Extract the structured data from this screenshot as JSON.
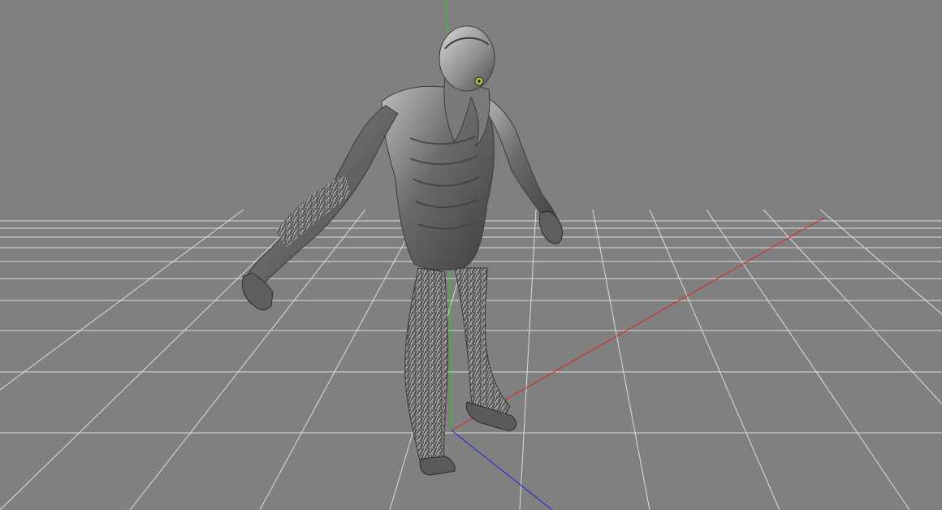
{
  "viewport": {
    "background_color": "#808080",
    "grid_color": "#e6e6e6",
    "model_base_color": "#6f6f6f",
    "model_highlight_color": "#c8c8c8",
    "model_shadow_color": "#3a3a3a",
    "eye_color": "#b7c24a"
  },
  "axes": {
    "x_axis_color": "#e02020",
    "y_axis_color": "#20d020",
    "z_axis_color": "#2020e0"
  },
  "icons": {
    "model": "creature-model",
    "grid": "ground-grid"
  }
}
